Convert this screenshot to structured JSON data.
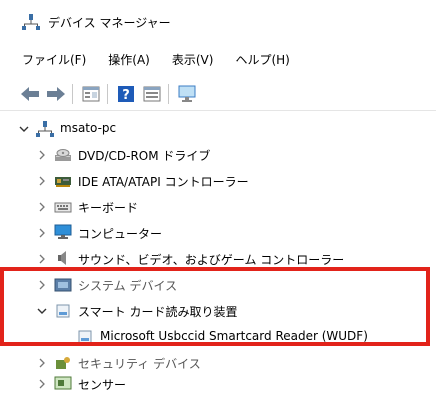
{
  "window": {
    "title": "デバイス マネージャー"
  },
  "menu": [
    {
      "label": "ファイル(F)"
    },
    {
      "label": "操作(A)"
    },
    {
      "label": "表示(V)"
    },
    {
      "label": "ヘルプ(H)"
    }
  ],
  "toolbar": {
    "icons": [
      "back-arrow-icon",
      "forward-arrow-icon",
      "properties-icon",
      "help-icon",
      "view-icon",
      "monitor-scan-icon"
    ]
  },
  "tree": {
    "root": {
      "label": "msato-pc",
      "expanded": true
    },
    "items": [
      {
        "label": "DVD/CD-ROM ドライブ",
        "icon": "dvd-drive-icon",
        "expanded": false
      },
      {
        "label": "IDE ATA/ATAPI コントローラー",
        "icon": "ide-controller-icon",
        "expanded": false
      },
      {
        "label": "キーボード",
        "icon": "keyboard-icon",
        "expanded": false
      },
      {
        "label": "コンピューター",
        "icon": "computer-icon",
        "expanded": false
      },
      {
        "label": "サウンド、ビデオ、およびゲーム コントローラー",
        "icon": "speaker-icon",
        "expanded": false
      },
      {
        "label": "システム デバイス",
        "icon": "system-device-icon",
        "expanded": false
      },
      {
        "label": "スマート カード読み取り装置",
        "icon": "smartcard-reader-icon",
        "expanded": true
      },
      {
        "label": "Microsoft Usbccid Smartcard Reader (WUDF)",
        "icon": "smartcard-device-icon",
        "child": true
      },
      {
        "label": "セキュリティ デバイス",
        "icon": "security-device-icon",
        "expanded": false
      },
      {
        "label": "センサー",
        "icon": "sensor-icon",
        "expanded": false
      }
    ]
  },
  "colors": {
    "highlight": "#e2231a",
    "accent": "#1e73be"
  }
}
